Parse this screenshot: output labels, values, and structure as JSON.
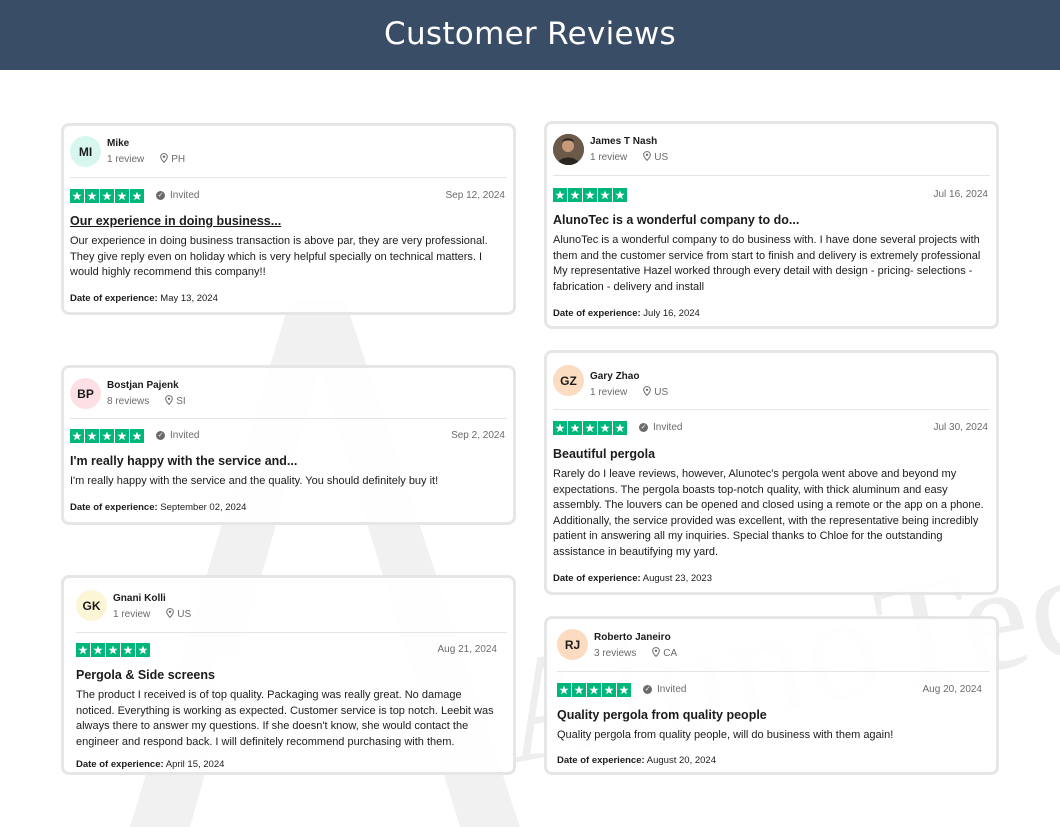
{
  "header": {
    "title": "Customer Reviews"
  },
  "watermark": {
    "text": "AlunoTec"
  },
  "colors": {
    "header_bg": "#3a4d66",
    "star_green": "#00b67a"
  },
  "labels": {
    "invited": "Invited",
    "date_of_experience": "Date of experience:"
  },
  "reviews": [
    {
      "initials": "MI",
      "name": "Mike",
      "review_count": "1 review",
      "country": "PH",
      "rating": 5,
      "invited": true,
      "date": "Sep 12, 2024",
      "title": "Our experience in doing business...",
      "body": "Our experience in doing business transaction is above par, they are very professional. They give reply even on holiday which is very helpful specially on technical matters. I would highly recommend this company!!",
      "experience_date": "May 13, 2024",
      "avatar_color": "#d7f6ef"
    },
    {
      "initials": "",
      "name": "James T Nash",
      "review_count": "1 review",
      "country": "US",
      "rating": 5,
      "invited": false,
      "date": "Jul 16, 2024",
      "title": "AlunoTec is a wonderful company to do...",
      "body": "AlunoTec is a wonderful company to do business with. I have done several projects with them and the customer service from start to finish and delivery is extremely professional My representative Hazel worked through every detail with design - pricing- selections - fabrication - delivery and install",
      "experience_date": "July 16, 2024",
      "avatar_color": "#5a4a3e"
    },
    {
      "initials": "BP",
      "name": "Bostjan Pajenk",
      "review_count": "8 reviews",
      "country": "SI",
      "rating": 5,
      "invited": true,
      "date": "Sep 2, 2024",
      "title": "I'm really happy with the service and...",
      "body": "I'm really happy with the service and the quality. You should definitely buy it!",
      "experience_date": "September 02, 2024",
      "avatar_color": "#fde0e5"
    },
    {
      "initials": "GZ",
      "name": "Gary Zhao",
      "review_count": "1 review",
      "country": "US",
      "rating": 5,
      "invited": true,
      "date": "Jul 30, 2024",
      "title": "Beautiful pergola",
      "body": "Rarely do I leave reviews, however, Alunotec's pergola went above and beyond my expectations. The pergola boasts top-notch quality, with thick aluminum and easy assembly. The louvers can be opened and closed using a remote or the app on a phone. Additionally, the service provided was excellent, with the representative being incredibly patient in answering all my inquiries. Special thanks to Chloe for the outstanding assistance in beautifying my yard.",
      "experience_date": "August 23, 2023",
      "avatar_color": "#fcdcc0"
    },
    {
      "initials": "GK",
      "name": "Gnani Kolli",
      "review_count": "1 review",
      "country": "US",
      "rating": 5,
      "invited": false,
      "date": "Aug 21, 2024",
      "title": "Pergola & Side screens",
      "body": "The product I received is of top quality. Packaging was really great. No damage noticed. Everything is working as expected. Customer service is top notch. Leebit was always there to answer my questions. If she doesn't know, she would contact the engineer and respond back. I will definitely recommend purchasing with them.",
      "experience_date": "April 15, 2024",
      "avatar_color": "#fdf6d6"
    },
    {
      "initials": "RJ",
      "name": "Roberto Janeiro",
      "review_count": "3 reviews",
      "country": "CA",
      "rating": 5,
      "invited": true,
      "date": "Aug 20, 2024",
      "title": "Quality pergola from quality people",
      "body": "Quality pergola from quality people, will do business with them again!",
      "experience_date": "August 20, 2024",
      "avatar_color": "#fcdcc0"
    }
  ]
}
